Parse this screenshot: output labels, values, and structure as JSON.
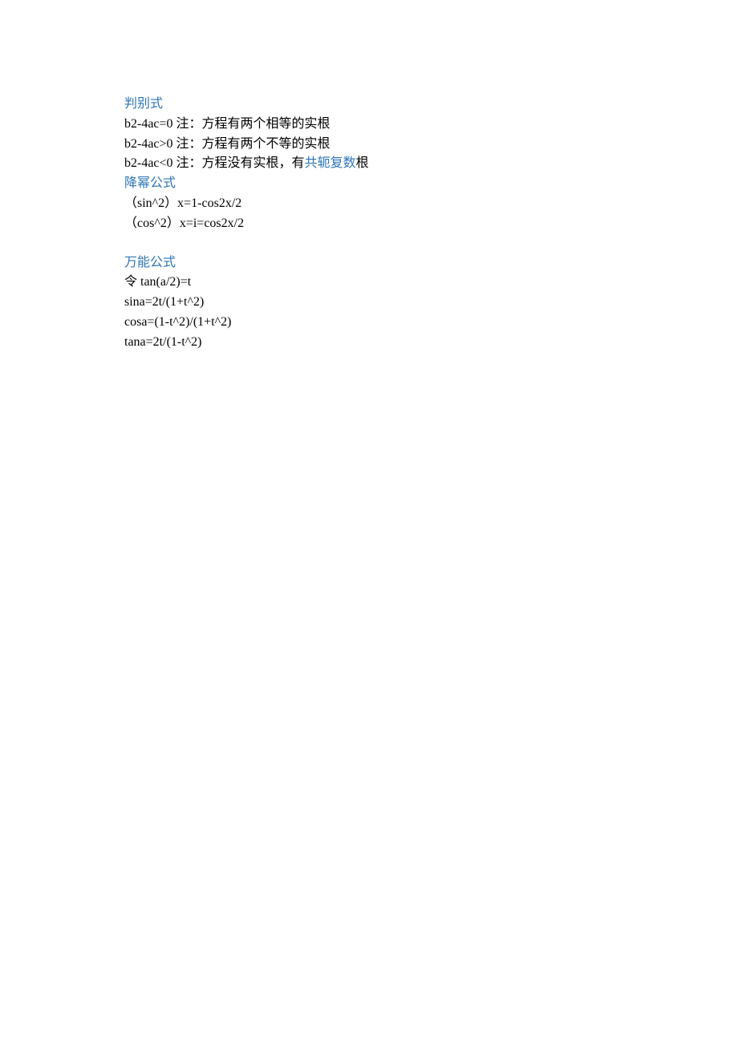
{
  "colors": {
    "link": "#2e75b6",
    "text": "#000000"
  },
  "section1": {
    "heading": "判别式",
    "lines": [
      "b2-4ac=0 注：方程有两个相等的实根",
      "b2-4ac>0 注：方程有两个不等的实根",
      {
        "prefix": "b2-4ac<0 注：方程没有实根，有",
        "link": "共轭复数",
        "suffix": "根"
      }
    ]
  },
  "section2": {
    "heading": "降幂公式",
    "lines": [
      "（sin^2）x=1-cos2x/2",
      "（cos^2）x=i=cos2x/2"
    ]
  },
  "section3": {
    "heading": "万能公式",
    "lines": [
      "令 tan(a/2)=t",
      "sina=2t/(1+t^2)",
      "cosa=(1-t^2)/(1+t^2)",
      "tana=2t/(1-t^2)"
    ]
  }
}
